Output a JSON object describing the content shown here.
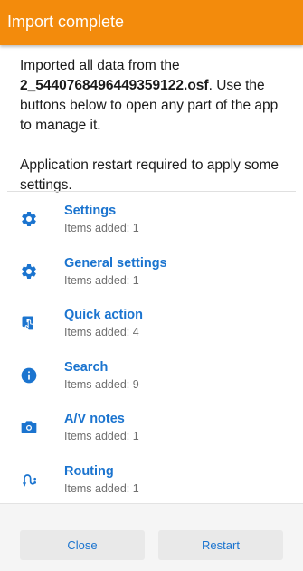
{
  "header": {
    "title": "Import complete"
  },
  "message": {
    "prefix": "Imported all data from the ",
    "filename": "2_5440768496449359122.osf",
    "suffix": ". Use the buttons below to open any part of the app to manage it.",
    "restart_note": "Application restart required to apply some settings."
  },
  "items": [
    {
      "title": "Settings",
      "subtitle": "Items added: 1",
      "icon": "gear-icon"
    },
    {
      "title": "General settings",
      "subtitle": "Items added: 1",
      "icon": "gear-icon"
    },
    {
      "title": "Quick action",
      "subtitle": "Items added: 4",
      "icon": "quick-action-icon"
    },
    {
      "title": "Search",
      "subtitle": "Items added: 9",
      "icon": "info-icon"
    },
    {
      "title": "A/V notes",
      "subtitle": "Items added: 1",
      "icon": "camera-icon"
    },
    {
      "title": "Routing",
      "subtitle": "Items added: 1",
      "icon": "routing-icon"
    }
  ],
  "footer": {
    "close_label": "Close",
    "restart_label": "Restart"
  },
  "colors": {
    "header_bg": "#f38b0c",
    "accent": "#1b74cf"
  }
}
